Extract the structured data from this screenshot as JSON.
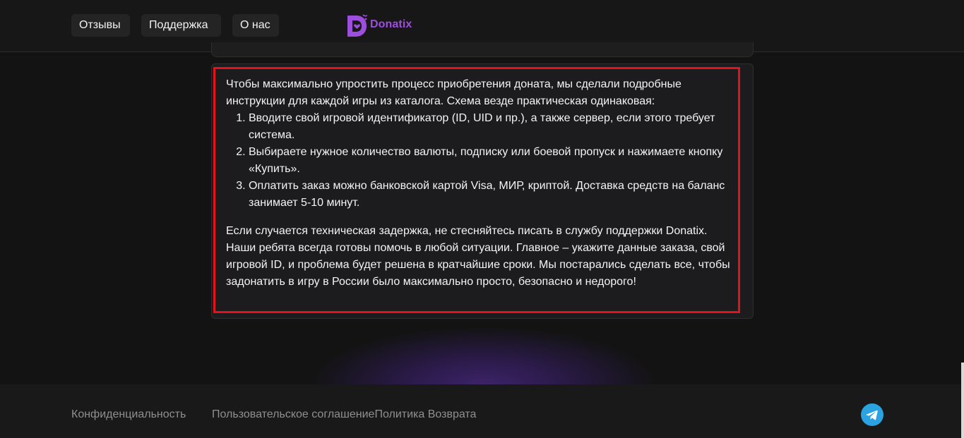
{
  "header": {
    "nav": [
      {
        "label": "Отзывы"
      },
      {
        "label": "Поддержка"
      },
      {
        "label": "О нас"
      }
    ],
    "logo_text": "Donatix",
    "brand_color": "#9d4edd"
  },
  "content": {
    "intro": "Чтобы максимально упростить процесс приобретения доната, мы сделали подробные инструкции для каждой игры из каталога. Схема везде практическая одинаковая:",
    "steps": [
      "Вводите свой игровой идентификатор (ID, UID и пр.), а также сервер, если этого требует система.",
      "Выбираете нужное количество валюты, подписку или боевой пропуск и нажимаете кнопку «Купить».",
      "Оплатить заказ можно банковской картой Visa, МИР, криптой. Доставка средств на баланс занимает 5-10 минут."
    ],
    "outro": "Если случается техническая задержка, не стесняйтесь писать в службу поддержки Donatix. Наши ребята всегда готовы помочь в любой ситуации. Главное – укажите данные заказа, свой игровой ID, и проблема будет решена в кратчайшие сроки. Мы постарались сделать все, чтобы задонатить в игру в России было максимально просто, безопасно и недорого!",
    "highlight_color": "#e5121a"
  },
  "footer": {
    "links": [
      {
        "label": "Конфиденциальность"
      },
      {
        "label": "Пользовательское соглашениеПолитика Возврата"
      }
    ],
    "social_icon": "telegram-icon"
  }
}
